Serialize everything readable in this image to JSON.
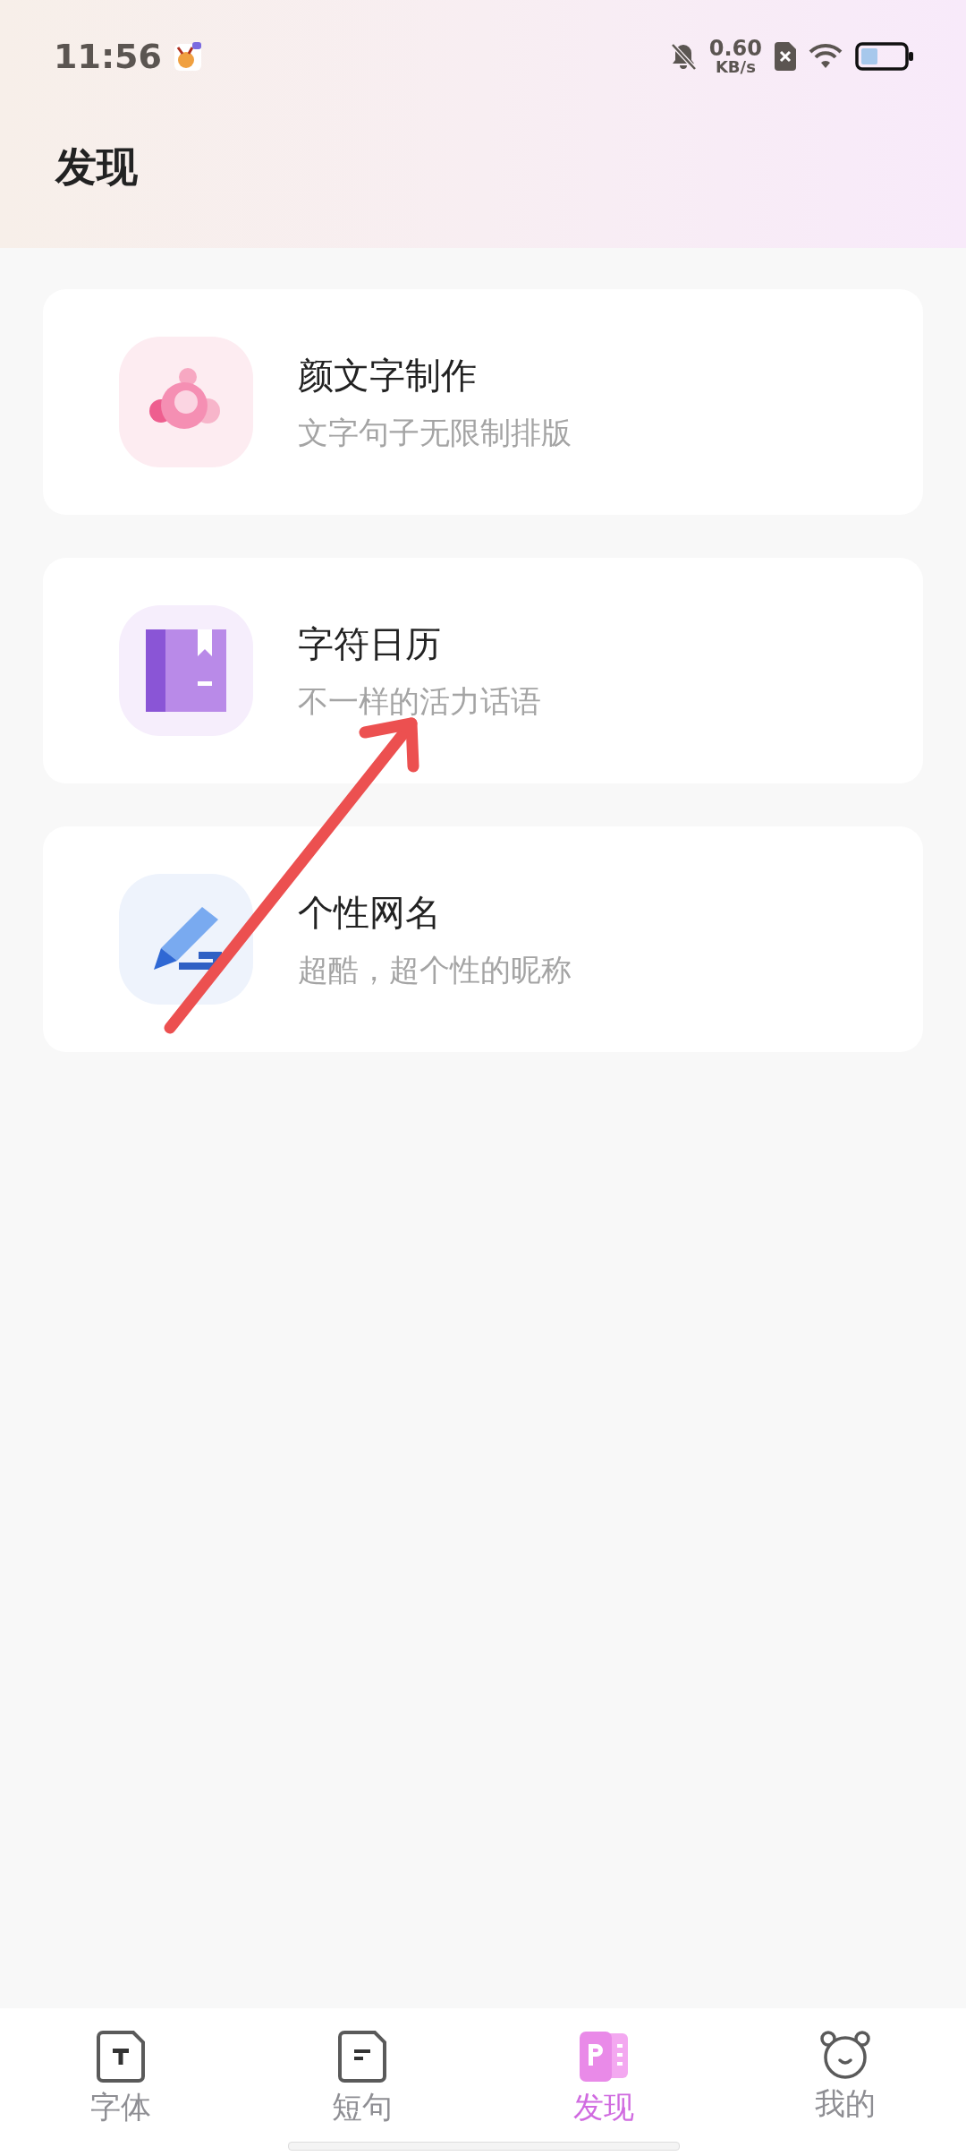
{
  "status_bar": {
    "time": "11:56",
    "net_speed": "0.60",
    "net_unit": "KB/s"
  },
  "header": {
    "title": "发现"
  },
  "cards": [
    {
      "kind": "bubble",
      "title": "颜文字制作",
      "subtitle": "文字句子无限制排版"
    },
    {
      "kind": "book",
      "title": "字符日历",
      "subtitle": "不一样的活力话语"
    },
    {
      "kind": "pen",
      "title": "个性网名",
      "subtitle": "超酷，超个性的昵称"
    }
  ],
  "tab_bar": [
    {
      "kind": "font",
      "label": "字体",
      "selected": false
    },
    {
      "kind": "sentence",
      "label": "短句",
      "selected": false
    },
    {
      "kind": "discover",
      "label": "发现",
      "selected": true
    },
    {
      "kind": "bear",
      "label": "我的",
      "selected": false
    }
  ]
}
